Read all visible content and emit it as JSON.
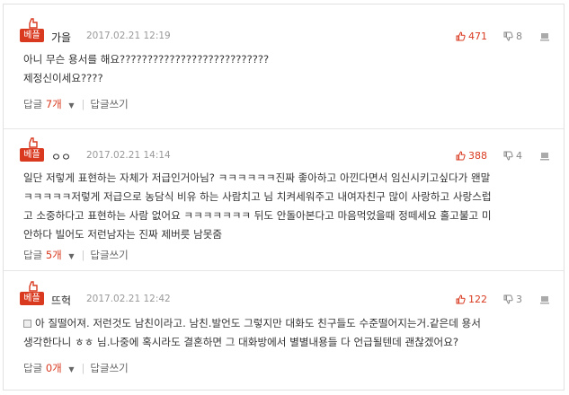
{
  "comments": [
    {
      "badge": "베플",
      "author": "가을",
      "time": "2017.02.21 12:19",
      "likes": "471",
      "dislikes": "8",
      "lines": [
        "아니 무슨 용서를 해요???????????????????????????",
        "제정신이세요????"
      ],
      "reply_label": "답글",
      "reply_count": "7개",
      "write_label": "답글쓰기"
    },
    {
      "badge": "베플",
      "author": "ㅇㅇ",
      "time": "2017.02.21 14:14",
      "likes": "388",
      "dislikes": "4",
      "lines": [
        "일단 저렇게 표현하는 자체가 저급인거아님? ㅋㅋㅋㅋㅋㅋ진짜 좋아하고 아낀다면서 임신시키고싶다가 왠말",
        "ㅋㅋㅋㅋㅋ저렇게 저급으로 농담식 비유 하는 사람치고 님 치켜세워주고 내여자친구 많이 사랑하고 사랑스럽",
        "고 소중하다고 표현하는 사람 없어요 ㅋㅋㅋㅋㅋㅋㅋ 뒤도 안돌아본다고 마음먹었을때 정떼세요 홀고불고 미",
        "안하다 빌어도 저런남자는 진짜 제버릇 남못줌"
      ],
      "reply_label": "답글",
      "reply_count": "5개",
      "write_label": "답글쓰기"
    },
    {
      "badge": "베플",
      "author": "뜨헉",
      "time": "2017.02.21 12:42",
      "likes": "122",
      "dislikes": "3",
      "lines": [
        "아 질떨어져. 저런것도 남친이라고. 남친.발언도 그렇지만 대화도 친구들도 수준떨어지는거.같은데 용서",
        "생각한다니 ㅎㅎ 님.나중에 혹시라도 결혼하면 그 대화방에서 별별내용들 다 언급될텐데 괜찮겠어요?"
      ],
      "reply_label": "답글",
      "reply_count": "0개",
      "write_label": "답글쓰기"
    }
  ],
  "colors": {
    "accent": "#d9391f",
    "muted": "#999999"
  },
  "icons": {
    "like": "thumbs-up-icon",
    "dislike": "thumbs-down-icon",
    "report": "report-icon",
    "badge": "best-crown-icon"
  }
}
